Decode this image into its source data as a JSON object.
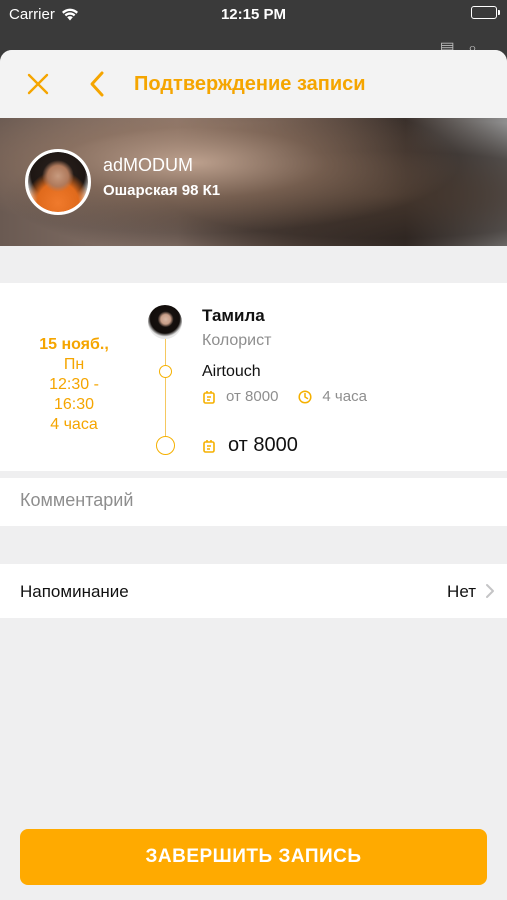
{
  "status_bar": {
    "carrier": "Carrier",
    "time": "12:15 PM"
  },
  "nav": {
    "title": "Подтверждение записи",
    "accent_color": "#f5a500"
  },
  "salon": {
    "name": "adMODUM",
    "address": "Ошарская 98 К1"
  },
  "appointment": {
    "date_line1": "15 нояб.,",
    "date_line2": "Пн",
    "time_line1": "12:30 -",
    "time_line2": "16:30",
    "duration": "4 часа",
    "master": {
      "name": "Тамила",
      "role": "Колорист"
    },
    "service": {
      "name": "Airtouch",
      "price": "от 8000",
      "duration": "4 часа"
    },
    "total": "от 8000"
  },
  "comment": {
    "placeholder": "Комментарий",
    "value": ""
  },
  "reminder": {
    "label": "Напоминание",
    "value": "Нет"
  },
  "actions": {
    "confirm_label": "ЗАВЕРШИТЬ ЗАПИСЬ",
    "button_color": "#ffaa00"
  }
}
